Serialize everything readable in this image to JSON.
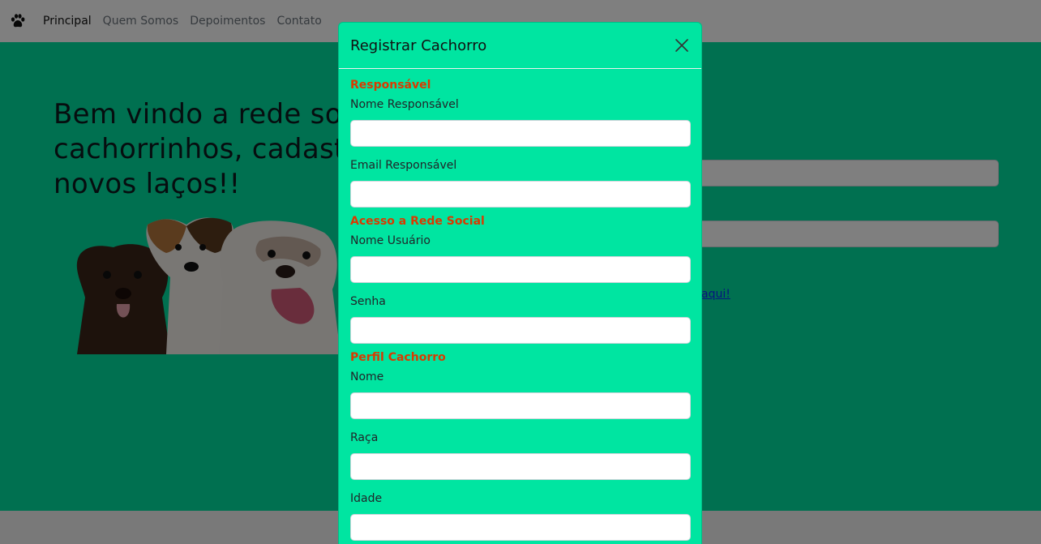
{
  "navbar": {
    "brand_icon": "paw-icon",
    "links": [
      "Principal",
      "Quem Somos",
      "Depoimentos",
      "Contato"
    ]
  },
  "hero": {
    "title": "Bem vindo a rede social de cachorrinhos, cadastre-se e crie novos laços!!",
    "background_color": "#00e0a0"
  },
  "login": {
    "register_link": "aqui!"
  },
  "modal": {
    "title": "Registrar Cachorro",
    "close_icon": "close-icon",
    "sections": {
      "responsavel": {
        "title": "Responsável",
        "nome_label": "Nome Responsável",
        "email_label": "Email Responsável"
      },
      "acesso": {
        "title": "Acesso a Rede Social",
        "usuario_label": "Nome Usuário",
        "senha_label": "Senha"
      },
      "perfil": {
        "title": "Perfil Cachorro",
        "nome_label": "Nome",
        "raca_label": "Raça",
        "idade_label": "Idade"
      }
    },
    "background_color": "#00e5a1",
    "section_title_color": "#d93a00"
  }
}
